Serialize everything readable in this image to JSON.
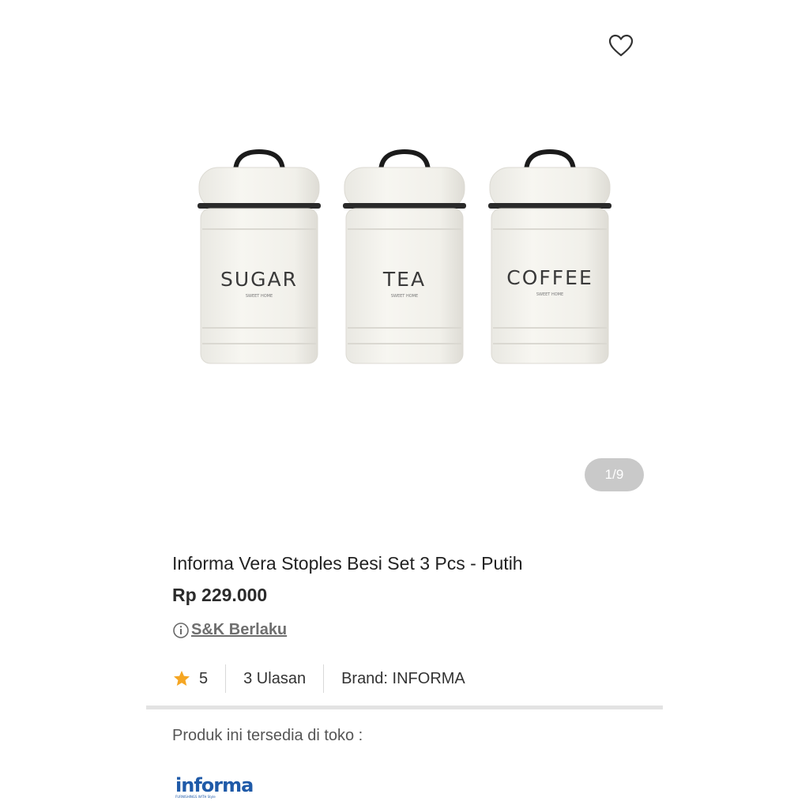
{
  "image": {
    "counter": "1/9"
  },
  "product": {
    "title": "Informa Vera Stoples Besi Set 3 Pcs - Putih",
    "price": "Rp 229.000",
    "terms_label": "S&K Berlaku",
    "rating": "5",
    "reviews": "3 Ulasan",
    "brand_prefix": "Brand: ",
    "brand": "INFORMA"
  },
  "canisters": [
    "SUGAR",
    "TEA",
    "COFFEE"
  ],
  "canister_subtitle": "SWEET HOME",
  "store": {
    "availability_text": "Produk ini tersedia di toko :",
    "logo_text": "informa",
    "logo_tagline": "FURNISHINGS WITH Style"
  },
  "icons": {
    "wishlist": "heart-outline-icon",
    "terms": "info-icon",
    "rating": "star-icon"
  },
  "colors": {
    "star": "#f5a623",
    "logo": "#1f5aa8"
  }
}
